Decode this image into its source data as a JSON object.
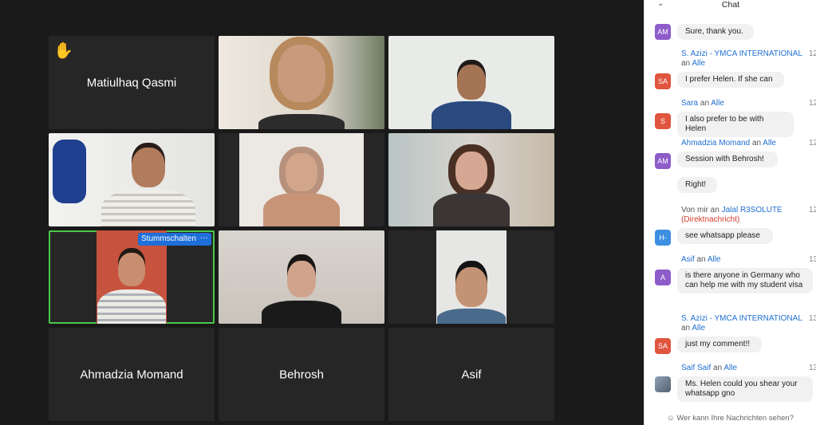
{
  "participants": {
    "matiulhaq": "Matiulhaq Qasmi",
    "ahmadzia": "Ahmadzia Momand",
    "behrosh": "Behrosh",
    "asif": "Asif"
  },
  "active_tile": {
    "mute_label": "Stummschalten",
    "more_label": "···"
  },
  "chat": {
    "title": "Chat",
    "collapse_icon": "chevron-down-icon",
    "messages": [
      {
        "avatar": "AM",
        "avatar_color": "#8d5cc9",
        "text": "Sure, thank you."
      },
      {
        "sender": "S. Azizi - YMCA INTERNATIONAL",
        "time": "12",
        "to_prefix": "an",
        "to": "Alle",
        "avatar": "SA",
        "avatar_color": "#e0553e",
        "text": "I prefer Helen. If she can"
      },
      {
        "sender": "Sara",
        "to_prefix": "an",
        "to": "Alle",
        "time": "12",
        "avatar": "S",
        "avatar_color": "#e0553e",
        "text": "I also prefer to be with Helen"
      },
      {
        "sender": "Ahmadzia Momand",
        "to_prefix": "an",
        "to": "Alle",
        "time": "12",
        "avatar": "AM",
        "avatar_color": "#8d5cc9",
        "text": "Session with Behrosh!"
      },
      {
        "text": "Right!"
      },
      {
        "sender_prefix": "Von mir an",
        "to": "Jalal R3SOLUTE",
        "dm_label": "(Direktnachricht)",
        "time": "12",
        "avatar": "H-",
        "avatar_color": "#3d8fe0",
        "text": "see whatsapp please"
      },
      {
        "sender": "Asif",
        "to_prefix": "an",
        "to": "Alle",
        "time": "13",
        "avatar": "A",
        "avatar_color": "#8d5cc9",
        "text": "is there anyone in Germany who can help me with my student visa"
      },
      {
        "sender": "S. Azizi - YMCA INTERNATIONAL",
        "time": "13",
        "to_prefix": "an",
        "to": "Alle",
        "avatar": "SA",
        "avatar_color": "#e0553e",
        "text": "just my comment!!"
      },
      {
        "sender": "Saif Saif",
        "to_prefix": "an",
        "to": "Alle",
        "time": "13",
        "avatar": "photo",
        "text": "Ms. Helen could you shear your whatsapp gno"
      }
    ],
    "footer": "Wer kann Ihre Nachrichten sehen?"
  }
}
